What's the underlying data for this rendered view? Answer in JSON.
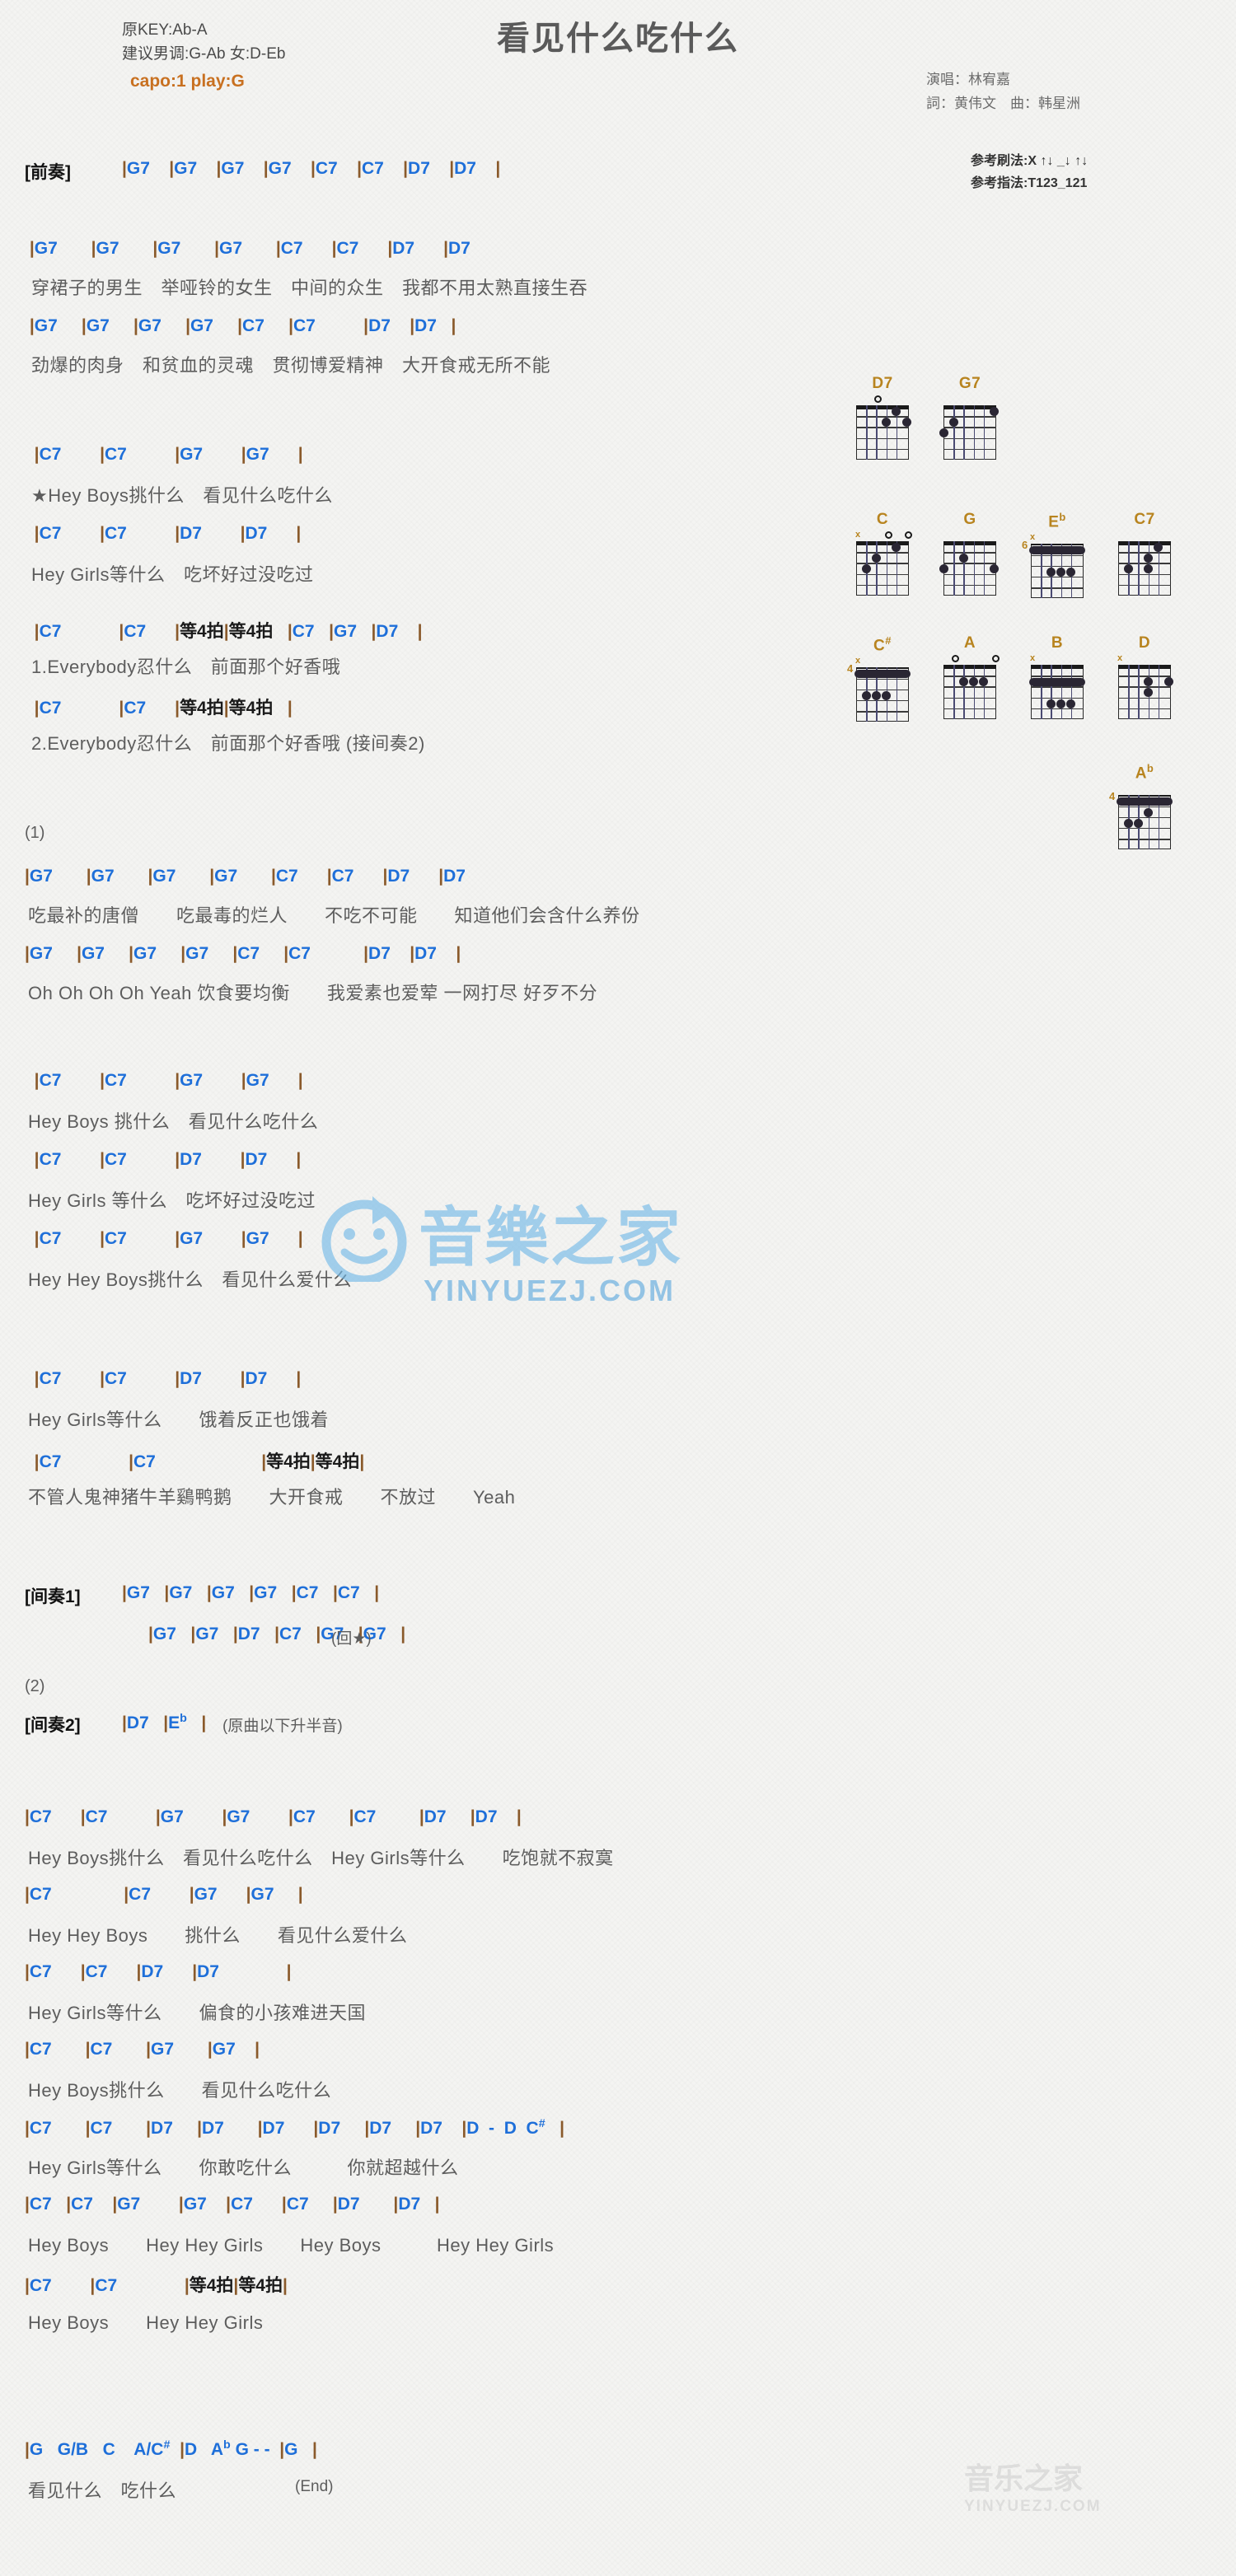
{
  "header": {
    "orig_key": "原KEY:Ab-A",
    "suggest_key": "建议男调:G-Ab 女:D-Eb",
    "capo": "capo:1 play:G",
    "title": "看见什么吃什么",
    "singer": "演唱：林宥嘉",
    "credits": "詞：黄伟文　曲：韩星洲",
    "strum": "参考刷法:X ↑↓ _↓ ↑↓",
    "finger": "参考指法:T123_121"
  },
  "sections": {
    "prelude_tag": "[前奏]",
    "interlude1_tag": "[间奏1]",
    "interlude2_tag": "[间奏2]",
    "verse1_idx": "(1)",
    "verse2_idx": "(2)",
    "repeat_note": "(回★)",
    "interlude2_note": "(原曲以下升半音)",
    "end_note": "(End)"
  },
  "lines": {
    "prelude": "|G7    |G7    |G7    |G7    |C7    |C7    |D7    |D7    |",
    "v1c1": " |G7       |G7       |G7       |G7       |C7      |C7      |D7      |D7",
    "v1l1": "穿裙子的男生　举哑铃的女生　中间的众生　我都不用太熟直接生吞",
    "v1c2": " |G7     |G7     |G7     |G7     |C7     |C7          |D7    |D7   |",
    "v1l2": "劲爆的肉身　和贫血的灵魂　贯彻博爱精神　大开食戒无所不能",
    "ch1c1": "  |C7        |C7          |G7        |G7      |",
    "ch1l1": "★Hey Boys挑什么　看见什么吃什么",
    "ch1c2": "  |C7        |C7          |D7        |D7      |",
    "ch1l2": "Hey Girls等什么　吃坏好过没吃过",
    "ch1c3": "  |C7            |C7      |等4拍|等4拍   |C7   |G7   |D7    |",
    "ch1l3": "1.Everybody忍什么　前面那个好香哦",
    "ch1c4": "  |C7            |C7      |等4拍|等4拍   |",
    "ch1l4": "2.Everybody忍什么　前面那个好香哦 (接间奏2)",
    "v2c1": "|G7       |G7       |G7       |G7       |C7      |C7      |D7      |D7",
    "v2l1": "吃最补的唐僧　　吃最毒的烂人　　不吃不可能　　知道他们会含什么养份",
    "v2c2": "|G7     |G7     |G7     |G7     |C7     |C7           |D7    |D7    |",
    "v2l2": "Oh Oh Oh Oh Yeah 饮食要均衡　　我爱素也爱荤 一网打尽 好歹不分",
    "ch2c1": "  |C7        |C7          |G7        |G7      |",
    "ch2l1": "Hey Boys 挑什么　看见什么吃什么",
    "ch2c2": "  |C7        |C7          |D7        |D7      |",
    "ch2l2": "Hey Girls 等什么　吃坏好过没吃过",
    "ch2c3": "  |C7        |C7          |G7        |G7      |",
    "ch2l3": "Hey Hey Boys挑什么　看见什么爱什么",
    "ch2c4": "  |C7        |C7          |D7        |D7      |",
    "ch2l4": "Hey Girls等什么　　饿着反正也饿着",
    "ch2c5": "  |C7              |C7                      |等4拍|等4拍|",
    "ch2l5": "不管人鬼神猪牛羊鷄鸭鹅　　大开食戒　　不放过　　Yeah",
    "int1a": "|G7   |G7   |G7   |G7   |C7   |C7   |",
    "int1b": "|G7   |G7   |D7   |C7   |G7   |G7   |",
    "int2a": "|D7   |E♭   |",
    "ch3c1": "|C7      |C7          |G7        |G7        |C7       |C7         |D7     |D7    |",
    "ch3l1": "Hey Boys挑什么　看见什么吃什么　Hey Girls等什么　　吃饱就不寂寞",
    "ch3c2": "|C7               |C7        |G7      |G7     |",
    "ch3l2": "Hey Hey Boys　　挑什么　　看见什么爱什么",
    "ch3c3": "|C7      |C7      |D7      |D7              |",
    "ch3l3": "Hey Girls等什么　　偏食的小孩难进天国",
    "ch3c4": "|C7       |C7       |G7       |G7    |",
    "ch3l4": "Hey Boys挑什么　　看见什么吃什么",
    "ch3c5": "|C7       |C7       |D7     |D7       |D7      |D7     |D7     |D7    |D  -  D  C♯   |",
    "ch3l5": "Hey Girls等什么　　你敢吃什么　　　你就超越什么",
    "ch3c6": "|C7   |C7    |G7        |G7    |C7      |C7     |D7       |D7   |",
    "ch3l6": "Hey Boys　　Hey Hey Girls　　Hey Boys　　　Hey Hey Girls",
    "ch3c7": "|C7        |C7              |等4拍|等4拍|",
    "ch3l7": "Hey Boys　　Hey Hey Girls",
    "endc": "|G   G/B   C    A/C♯  |D   A♭ G - -  |G   |",
    "endl": "看见什么　吃什么"
  },
  "chord_diagrams": [
    {
      "name": "D7",
      "col": 0,
      "row": 0,
      "fret": "",
      "marks": [
        "",
        "",
        "o",
        "",
        "",
        ""
      ],
      "dots": [
        [
          2,
          3
        ],
        [
          1,
          4
        ],
        [
          2,
          5
        ]
      ]
    },
    {
      "name": "G7",
      "col": 1,
      "row": 0,
      "fret": "",
      "marks": [
        "",
        "",
        "",
        "",
        "",
        ""
      ],
      "dots": [
        [
          3,
          0
        ],
        [
          2,
          1
        ],
        [
          1,
          5
        ]
      ]
    },
    {
      "name": "C",
      "col": 0,
      "row": 1,
      "fret": "",
      "marks": [
        "x",
        "",
        "",
        "o",
        "",
        "o"
      ],
      "dots": [
        [
          3,
          1
        ],
        [
          2,
          2
        ],
        [
          1,
          4
        ]
      ]
    },
    {
      "name": "G",
      "col": 1,
      "row": 1,
      "fret": "",
      "marks": [
        "",
        "",
        "",
        "",
        "",
        ""
      ],
      "dots": [
        [
          3,
          0
        ],
        [
          2,
          2
        ],
        [
          3,
          5
        ]
      ]
    },
    {
      "name": "Eb",
      "col": 2,
      "row": 1,
      "fret": "6",
      "marks": [
        "x",
        "",
        "",
        "",
        "",
        ""
      ],
      "barre": 1,
      "dots": [
        [
          3,
          2
        ],
        [
          3,
          3
        ],
        [
          3,
          4
        ]
      ]
    },
    {
      "name": "C7",
      "col": 3,
      "row": 1,
      "fret": "",
      "marks": [
        "",
        "",
        "",
        "",
        "",
        ""
      ],
      "dots": [
        [
          1,
          4
        ],
        [
          2,
          3
        ],
        [
          3,
          1
        ],
        [
          3,
          3
        ]
      ]
    },
    {
      "name": "C#",
      "col": 0,
      "row": 2,
      "fret": "4",
      "marks": [
        "x",
        "",
        "",
        "",
        "",
        ""
      ],
      "barre": 1,
      "dots": [
        [
          3,
          1
        ],
        [
          3,
          2
        ],
        [
          3,
          3
        ]
      ]
    },
    {
      "name": "A",
      "col": 1,
      "row": 2,
      "fret": "",
      "marks": [
        "",
        "o",
        "",
        "",
        "",
        "o"
      ],
      "dots": [
        [
          2,
          2
        ],
        [
          2,
          3
        ],
        [
          2,
          4
        ]
      ]
    },
    {
      "name": "B",
      "col": 2,
      "row": 2,
      "fret": "",
      "marks": [
        "x",
        "",
        "",
        "",
        "",
        ""
      ],
      "barre": 2,
      "dots": [
        [
          4,
          2
        ],
        [
          4,
          3
        ],
        [
          4,
          4
        ]
      ]
    },
    {
      "name": "D",
      "col": 3,
      "row": 2,
      "fret": "",
      "marks": [
        "x",
        "",
        "",
        "",
        "",
        ""
      ],
      "dots": [
        [
          2,
          3
        ],
        [
          3,
          3
        ],
        [
          2,
          5
        ]
      ]
    },
    {
      "name": "Ab",
      "col": 3,
      "row": 3,
      "fret": "4",
      "marks": [
        "",
        "",
        "",
        "",
        "",
        ""
      ],
      "barre": 1,
      "dots": [
        [
          2,
          3
        ],
        [
          3,
          1
        ],
        [
          3,
          2
        ]
      ]
    }
  ],
  "watermark": {
    "main": "音樂之家",
    "sub": "YINYUEZJ.COM",
    "corner": "音乐之家",
    "corner_sub": "YINYUEZJ.COM"
  }
}
